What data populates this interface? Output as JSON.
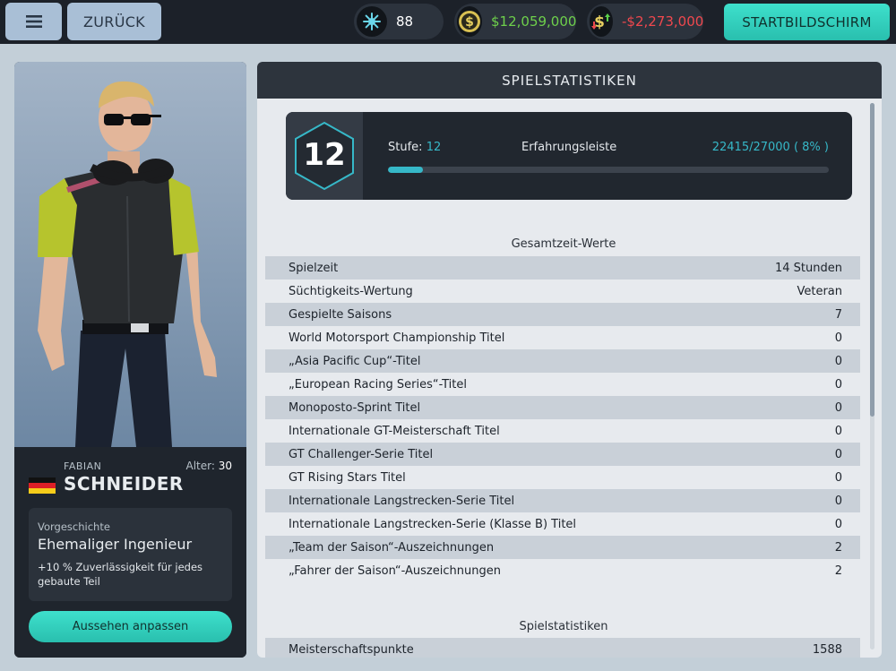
{
  "topbar": {
    "back_label": "ZURÜCK",
    "tokens": "88",
    "money": "$12,059,000",
    "money_color": "#6ed04b",
    "change": "-$2,273,000",
    "change_color": "#f0484e",
    "home_label": "STARTBILDSCHIRM",
    "accent": "#33d2c0"
  },
  "driver": {
    "first_name": "FABIAN",
    "last_name": "SCHNEIDER",
    "age_label": "Alter:",
    "age": "30",
    "country_flag": "flag-germany",
    "background_caption": "Vorgeschichte",
    "background_title": "Ehemaliger Ingenieur",
    "background_desc": "+10 % Zuverlässigkeit für jedes gebaute Teil",
    "customize_label": "Aussehen anpassen"
  },
  "stats": {
    "header": "SPIELSTATISTIKEN",
    "level": "12",
    "level_label": "Stufe:",
    "xp_label": "Erfahrungsleiste",
    "xp_value": "22415/27000 ( 8% )",
    "xp_fraction": 0.08,
    "section1_title": "Gesamtzeit-Werte",
    "rows": [
      {
        "label": "Spielzeit",
        "value": "14 Stunden"
      },
      {
        "label": "Süchtigkeits-Wertung",
        "value": "Veteran"
      },
      {
        "label": "Gespielte Saisons",
        "value": "7"
      },
      {
        "label": "World Motorsport Championship Titel",
        "value": "0"
      },
      {
        "label": "„Asia Pacific Cup“-Titel",
        "value": "0"
      },
      {
        "label": "„European Racing Series“-Titel",
        "value": "0"
      },
      {
        "label": "Monoposto-Sprint Titel",
        "value": "0"
      },
      {
        "label": "Internationale GT-Meisterschaft Titel",
        "value": "0"
      },
      {
        "label": "GT Challenger-Serie Titel",
        "value": "0"
      },
      {
        "label": "GT Rising Stars Titel",
        "value": "0"
      },
      {
        "label": "Internationale Langstrecken-Serie Titel",
        "value": "0"
      },
      {
        "label": "Internationale Langstrecken-Serie (Klasse B) Titel",
        "value": "0"
      },
      {
        "label": "„Team der Saison“-Auszeichnungen",
        "value": "2"
      },
      {
        "label": "„Fahrer der Saison“-Auszeichnungen",
        "value": "2"
      }
    ],
    "section2_title": "Spielstatistiken",
    "section2_rows": [
      {
        "label": "Meisterschaftspunkte",
        "value": "1588"
      }
    ]
  }
}
